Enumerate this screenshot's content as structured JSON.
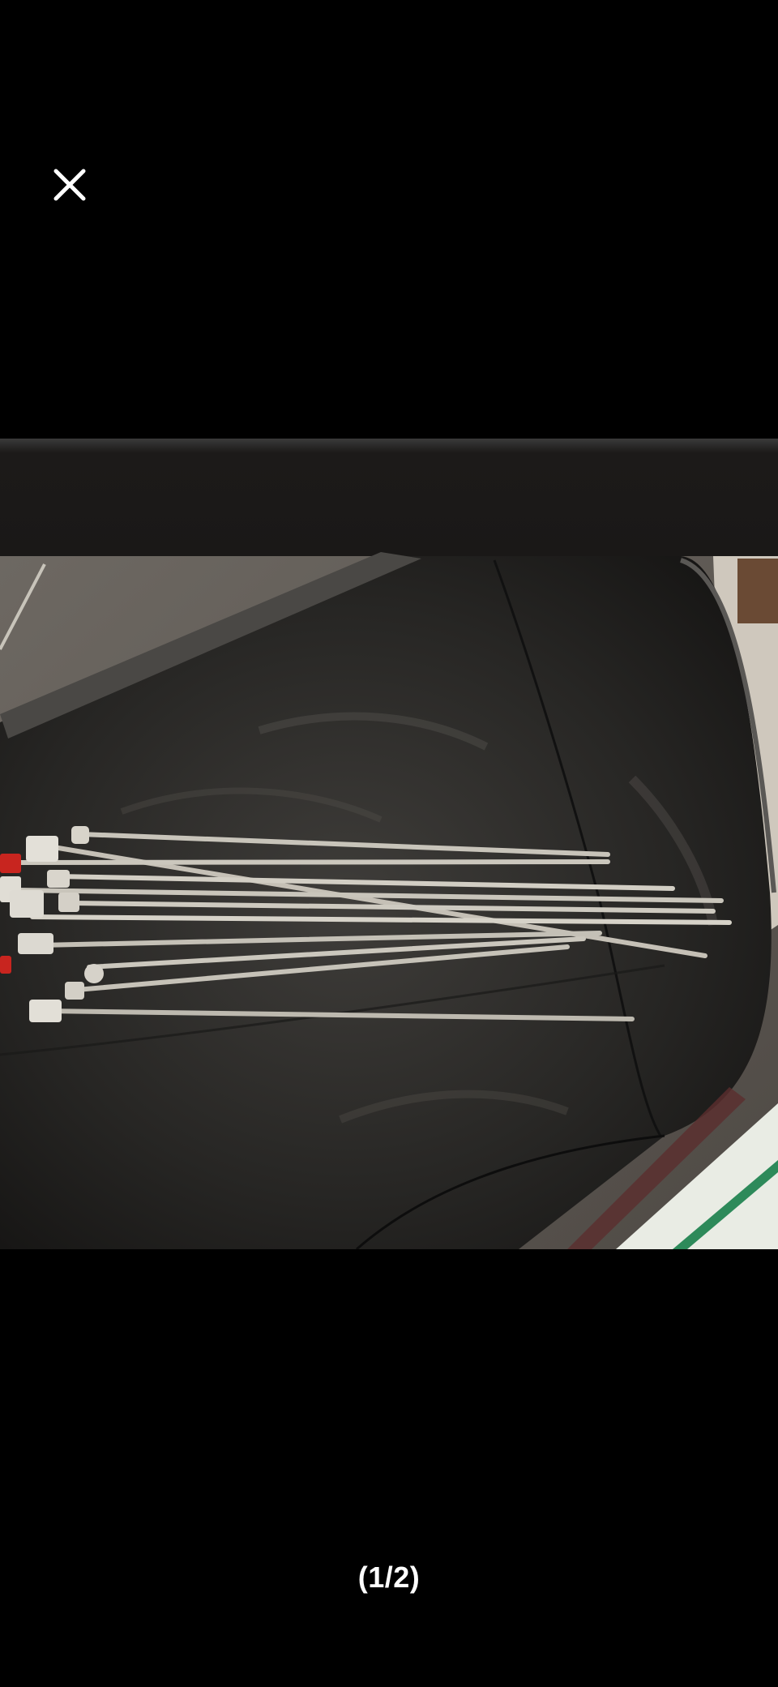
{
  "viewer": {
    "page_counter": "(1/2)",
    "close_icon": "close-icon",
    "background_color": "#000000"
  }
}
